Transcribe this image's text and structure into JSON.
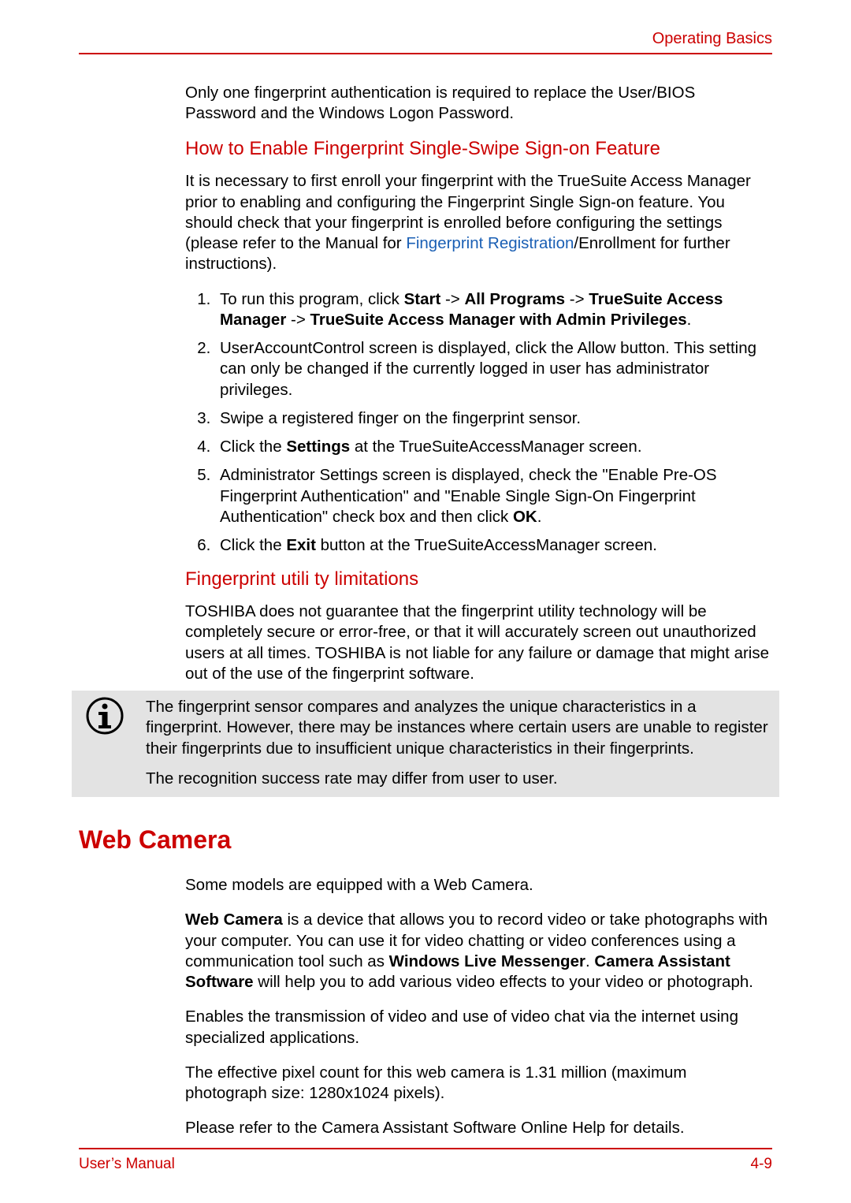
{
  "header": {
    "label": "Operating Basics"
  },
  "intro_para": "Only one fingerprint authentication is required to replace the User/BIOS Password and the Windows Logon Password.",
  "section_enable": {
    "heading": "How to Enable Fingerprint    Single-Swipe Sign-on Feature",
    "intro_pre": "It is necessary to first enroll your fingerprint with the TrueSuite Access Manager prior to enabling and configuring the Fingerprint Single Sign-on feature. You should check that your fingerprint is enrolled before configuring the settings (please refer to the Manual for ",
    "intro_link": "Fingerprint Registration",
    "intro_post": "/Enrollment for further instructions).",
    "steps": [
      {
        "pre": "To run this program, click ",
        "b1": "Start",
        "t1": " -> ",
        "b2": "All Programs",
        "t2": " -> ",
        "b3": "TrueSuite Access Manager",
        "t3": " -> ",
        "b4": "TrueSuite Access Manager with Admin Privileges",
        "t4": "."
      },
      {
        "pre": "UserAccountControl screen is displayed, click the Allow button. This setting can only be changed if the currently logged in user has administrator privileges."
      },
      {
        "pre": "Swipe a registered finger on the fingerprint sensor."
      },
      {
        "pre": "Click the ",
        "b1": "Settings",
        "t1": " at the TrueSuiteAccessManager screen."
      },
      {
        "pre": "Administrator Settings screen is displayed, check the \"Enable Pre-OS Fingerprint Authentication\" and \"Enable Single Sign-On Fingerprint Authentication\" check box and then click ",
        "b1": "OK",
        "t1": "."
      },
      {
        "pre": "Click the ",
        "b1": "Exit",
        "t1": " button at the  TrueSuiteAccessManager screen."
      }
    ]
  },
  "section_limits": {
    "heading": "Fingerprint utili   ty limitations",
    "para": "TOSHIBA does not guarantee that the fingerprint utility technology will be completely secure or error-free, or that it will accurately screen out unauthorized users at all times. TOSHIBA is not liable for any failure or damage that might arise out of the use of the fingerprint software."
  },
  "note": {
    "p1": "The fingerprint sensor compares and analyzes the unique characteristics in a fingerprint. However, there may be instances where certain users are unable to register their fingerprints due to insufficient unique characteristics in their fingerprints.",
    "p2": "The recognition success rate may differ from user to user."
  },
  "section_webcam": {
    "heading": "Web Camera",
    "p1": "Some models are equipped with a Web Camera.",
    "p2_b1": "Web Camera",
    "p2_t1": " is a device that allows you to record video or take photographs with your computer. You can use it for video chatting or video conferences using a communication tool such as ",
    "p2_b2": "Windows Live Messenger",
    "p2_t2": ". ",
    "p2_b3": "Camera Assistant Software",
    "p2_t3": " will help you to add various video effects to your video or photograph.",
    "p3": "Enables the transmission of video and use of video chat via the internet using specialized applications.",
    "p4": "The effective pixel count for this web camera is 1.31 million (maximum photograph size: 1280x1024 pixels).",
    "p5": "Please refer to the Camera Assistant Software Online Help for details."
  },
  "footer": {
    "left": "User’s Manual",
    "right": "4-9"
  }
}
